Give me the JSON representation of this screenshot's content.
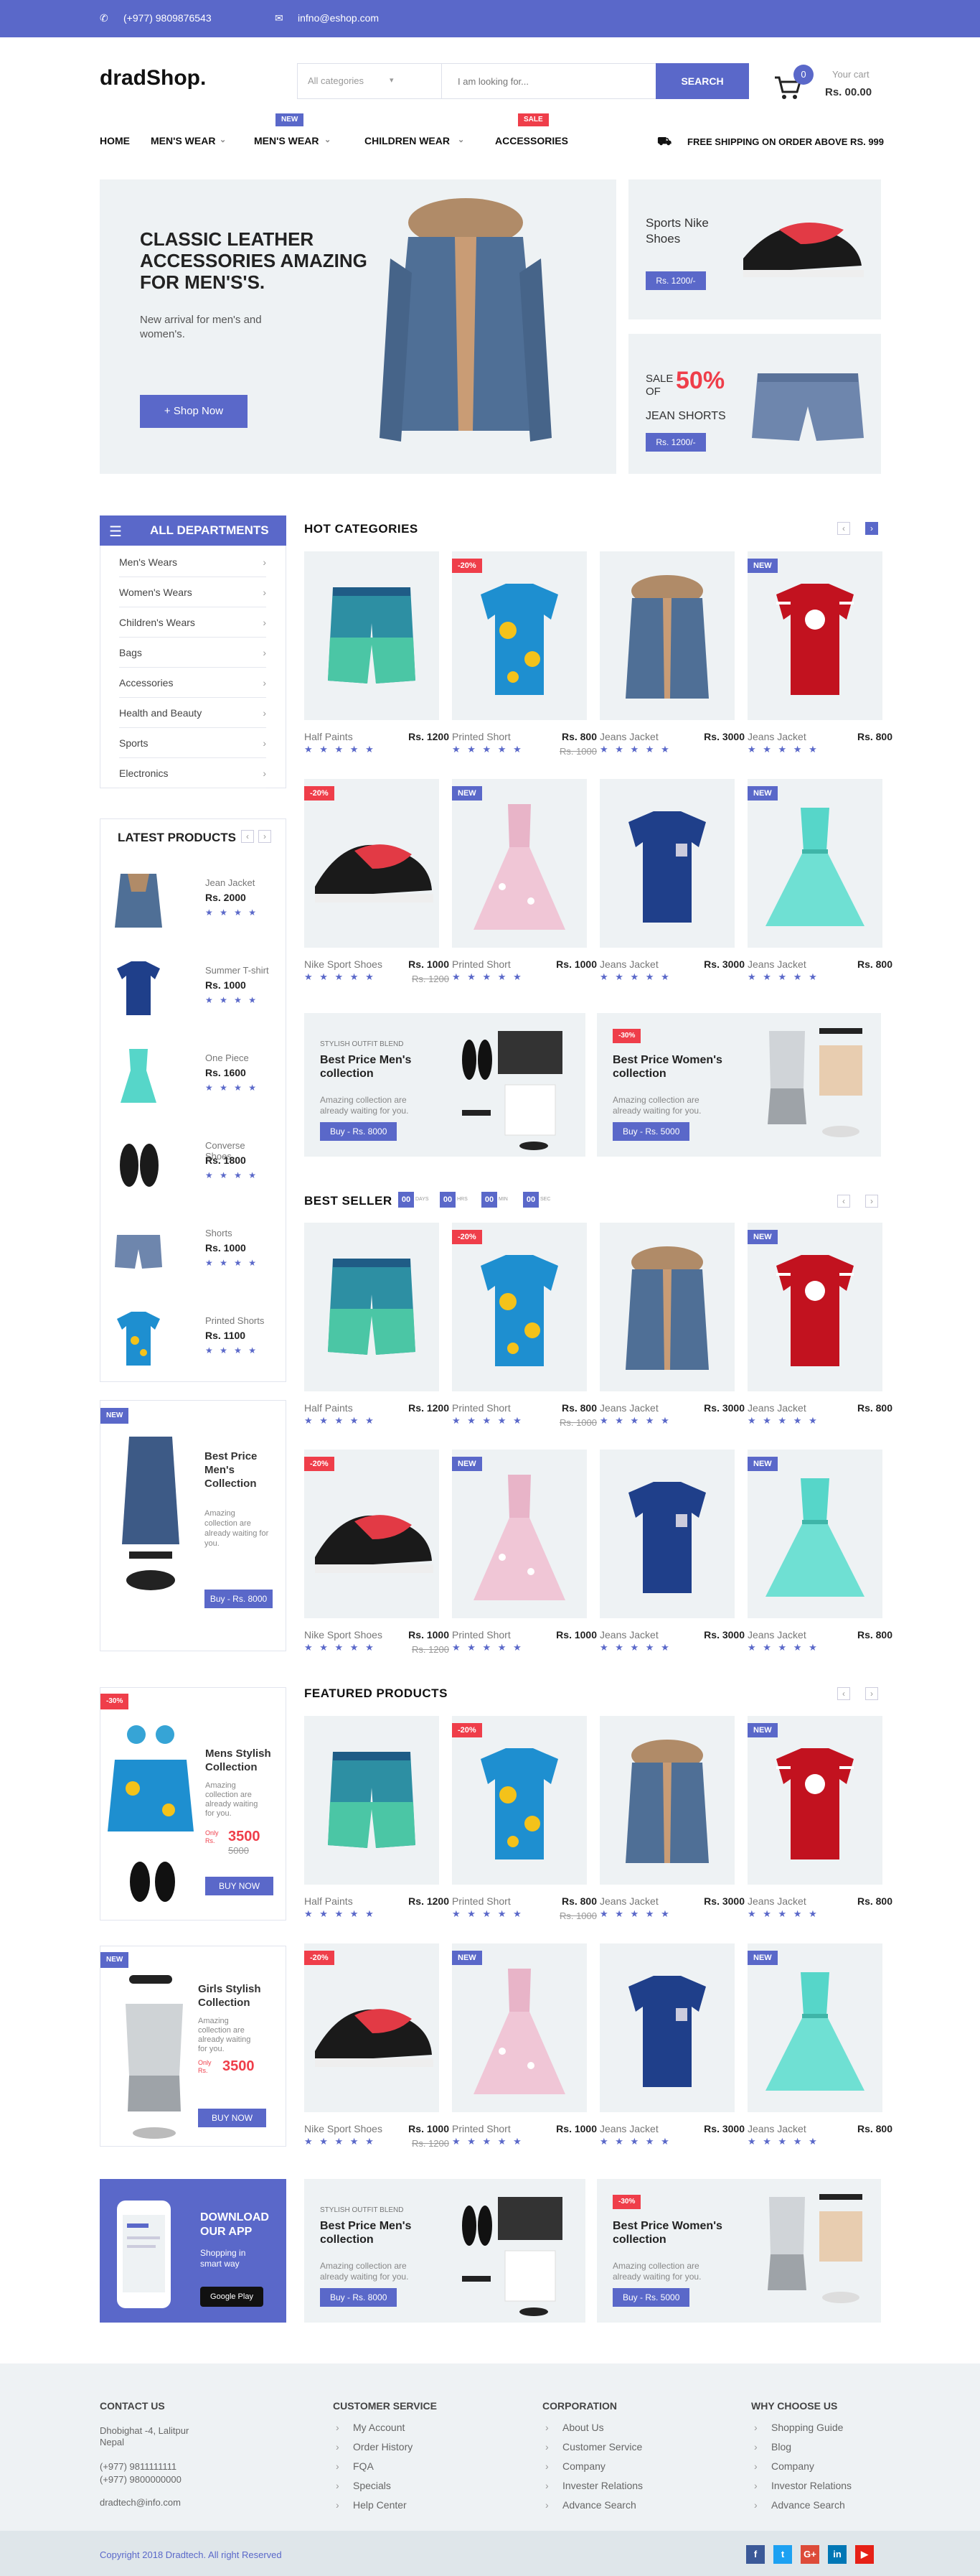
{
  "topbar": {
    "phone": "(+977) 9809876543",
    "email": "infno@eshop.com"
  },
  "header": {
    "logo": "dradShop.",
    "category": "All categories",
    "search_placeholder": "I am looking for...",
    "search_button": "SEARCH",
    "cart_count": "0",
    "cart_label": "Your cart",
    "cart_total": "Rs. 00.00"
  },
  "nav": {
    "items": [
      "HOME",
      "MEN'S WEAR",
      "MEN'S WEAR",
      "CHILDREN WEAR",
      "ACCESSORIES"
    ],
    "tag_new": "NEW",
    "tag_sale": "SALE",
    "shipping": "FREE SHIPPING ON ORDER ABOVE RS. 999"
  },
  "hero": {
    "title": "CLASSIC LEATHER ACCESSORIES AMAZING FOR MEN'S'S.",
    "subtitle": "New arrival for men's and women's.",
    "button": "+ Shop Now",
    "side1_title": "Sports Nike Shoes",
    "side1_price": "Rs. 1200/-",
    "side2_sale": "SALE",
    "side2_of": "OF",
    "side2_pct": "50%",
    "side2_title": "JEAN SHORTS",
    "side2_price": "Rs. 1200/-"
  },
  "departments": {
    "title": "ALL DEPARTMENTS",
    "items": [
      "Men's Wears",
      "Women's Wears",
      "Children's Wears",
      "Bags",
      "Accessories",
      "Health and Beauty",
      "Sports",
      "Electronics"
    ]
  },
  "latest": {
    "title": "LATEST  PRODUCTS",
    "items": [
      {
        "name": "Jean Jacket",
        "price": "Rs. 2000",
        "stars": "★ ★ ★ ★"
      },
      {
        "name": "Summer T-shirt",
        "price": "Rs. 1000",
        "stars": "★ ★ ★ ★"
      },
      {
        "name": "One Piece",
        "price": "Rs. 1600",
        "stars": "★ ★ ★ ★"
      },
      {
        "name": "Converse Shoes",
        "price": "Rs. 1800",
        "stars": "★ ★ ★ ★"
      },
      {
        "name": "Shorts",
        "price": "Rs. 1000",
        "stars": "★ ★ ★ ★"
      },
      {
        "name": "Printed Shorts",
        "price": "Rs. 1100",
        "stars": "★ ★ ★ ★"
      }
    ]
  },
  "side_promos": [
    {
      "tag": "NEW",
      "title": "Best Price Men's Collection",
      "desc": "Amazing collection are already waiting for you.",
      "button": "Buy - Rs. 8000"
    },
    {
      "tag": "-30%",
      "title": "Mens Stylish Collection",
      "desc": "Amazing collection are already waiting for you.",
      "only": "Only Rs.",
      "price": "3500",
      "old": "5000",
      "button": "BUY NOW"
    },
    {
      "tag": "NEW",
      "title": "Girls Stylish Collection",
      "desc": "Amazing collection are already waiting for you.",
      "only": "Only Rs.",
      "price": "3500",
      "button": "BUY NOW"
    }
  ],
  "app": {
    "title": "DOWNLOAD OUR APP",
    "desc": "Shopping in smart way",
    "store": "Google Play"
  },
  "sections": {
    "hot": "HOT CATEGORIES",
    "best": "BEST SELLER",
    "featured": "FEATURED PRODUCTS",
    "timer": [
      "00",
      "DAYS",
      "00",
      "HRS",
      "00",
      "MIN",
      "00",
      "SEC"
    ]
  },
  "products": [
    {
      "name": "Half Paints",
      "price": "Rs. 1200",
      "old": "",
      "tag": "",
      "stars": "★ ★ ★ ★ ★"
    },
    {
      "name": "Printed Short",
      "price": "Rs. 800",
      "old": "Rs. 1000",
      "tag": "-20%",
      "stars": "★ ★ ★ ★ ★"
    },
    {
      "name": "Jeans Jacket",
      "price": "Rs. 3000",
      "old": "",
      "tag": "",
      "stars": "★ ★ ★ ★ ★"
    },
    {
      "name": "Jeans Jacket",
      "price": "Rs. 800",
      "old": "",
      "tag": "NEW",
      "stars": "★ ★ ★ ★ ★"
    },
    {
      "name": "Nike Sport Shoes",
      "price": "Rs. 1000",
      "old": "Rs. 1200",
      "tag": "-20%",
      "stars": "★ ★ ★ ★ ★"
    },
    {
      "name": "Printed Short",
      "price": "Rs. 1000",
      "old": "",
      "tag": "NEW",
      "stars": "★ ★ ★ ★ ★"
    },
    {
      "name": "Jeans Jacket",
      "price": "Rs. 3000",
      "old": "",
      "tag": "",
      "stars": "★ ★ ★ ★ ★"
    },
    {
      "name": "Jeans Jacket",
      "price": "Rs. 800",
      "old": "",
      "tag": "NEW",
      "stars": "★ ★ ★ ★ ★"
    }
  ],
  "promos": [
    {
      "small": "STYLISH OUTFIT BLEND",
      "title": "Best Price Men's collection",
      "desc": "Amazing collection are already waiting for you.",
      "button": "Buy - Rs. 8000",
      "tag": ""
    },
    {
      "small": "",
      "title": "Best Price Women's collection",
      "desc": "Amazing collection are already waiting for you.",
      "button": "Buy - Rs. 5000",
      "tag": "-30%"
    }
  ],
  "footer": {
    "contact_title": "CONTACT US",
    "address": "Dhobighat -4, Lalitpur Nepal",
    "phone1": "(+977) 9811111111",
    "phone2": "(+977) 9800000000",
    "email": "dradtech@info.com",
    "cols": [
      {
        "title": "CUSTOMER SERVICE",
        "items": [
          "My Account",
          "Order History",
          "FQA",
          "Specials",
          "Help Center"
        ]
      },
      {
        "title": "CORPORATION",
        "items": [
          "About Us",
          "Customer Service",
          "Company",
          "Invester Relations",
          "Advance Search"
        ]
      },
      {
        "title": "WHY CHOOSE US",
        "items": [
          "Shopping Guide",
          "Blog",
          "Company",
          "Investor Relations",
          "Advance Search"
        ]
      }
    ],
    "copyright": "Copyright 2018 Dradtech. All right Reserved",
    "social": [
      "f",
      "t",
      "G+",
      "in",
      "▶"
    ]
  },
  "colors": {
    "accent": "#5a68c9",
    "sale": "#ef3e4a",
    "panel": "#eef2f4"
  }
}
